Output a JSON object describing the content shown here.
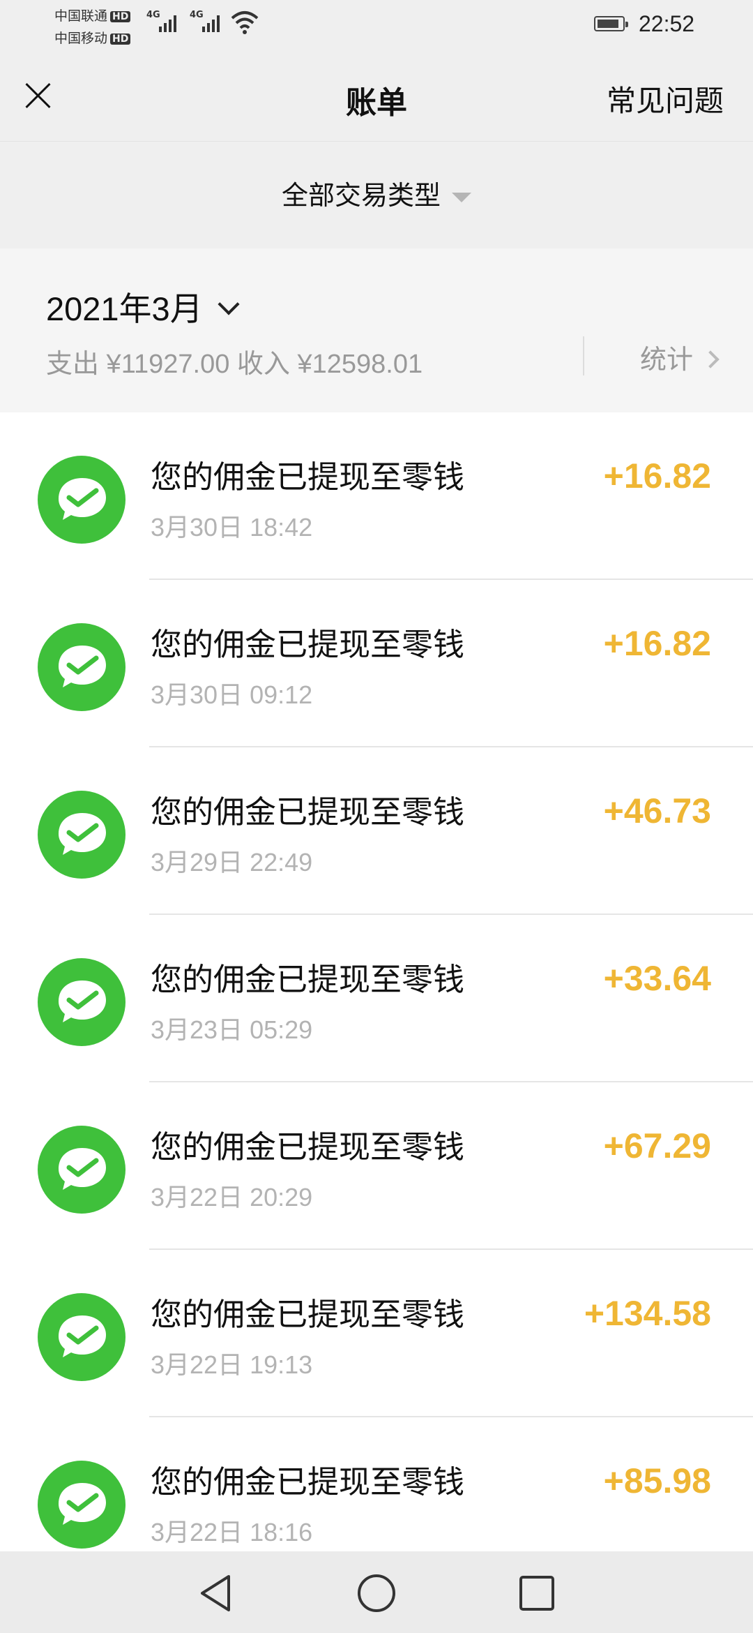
{
  "status_bar": {
    "carrier1": "中国联通",
    "carrier2": "中国移动",
    "hd_label": "HD",
    "network_label": "4G",
    "time": "22:52"
  },
  "header": {
    "title": "账单",
    "faq": "常见问题",
    "close_icon": "close-icon"
  },
  "filter": {
    "label": "全部交易类型"
  },
  "summary": {
    "month": "2021年3月",
    "totals": "支出 ¥11927.00 收入 ¥12598.01",
    "stats_label": "统计"
  },
  "colors": {
    "amount": "#efb634",
    "icon_green": "#3fc03b",
    "background": "#efefef"
  },
  "transactions": [
    {
      "title": "您的佣金已提现至零钱",
      "time": "3月30日 18:42",
      "amount": "+16.82"
    },
    {
      "title": "您的佣金已提现至零钱",
      "time": "3月30日 09:12",
      "amount": "+16.82"
    },
    {
      "title": "您的佣金已提现至零钱",
      "time": "3月29日 22:49",
      "amount": "+46.73"
    },
    {
      "title": "您的佣金已提现至零钱",
      "time": "3月23日 05:29",
      "amount": "+33.64"
    },
    {
      "title": "您的佣金已提现至零钱",
      "time": "3月22日 20:29",
      "amount": "+67.29"
    },
    {
      "title": "您的佣金已提现至零钱",
      "time": "3月22日 19:13",
      "amount": "+134.58"
    },
    {
      "title": "您的佣金已提现至零钱",
      "time": "3月22日 18:16",
      "amount": "+85.98"
    }
  ]
}
